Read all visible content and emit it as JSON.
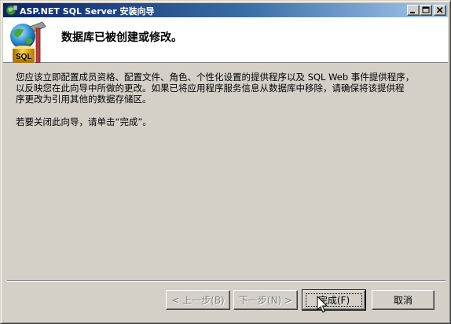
{
  "window": {
    "title": "ASP.NET SQL Server 安装向导"
  },
  "titlebar_buttons": {
    "minimize": "minimize-icon",
    "maximize": "maximize-icon",
    "close": "close-icon"
  },
  "header": {
    "title": "数据库已被创建或修改。",
    "icon_badge": "SQL"
  },
  "body": {
    "paragraph1_line1": "您应该立即配置成员资格、配置文件、角色、个性化设置的提供程序以及 SQL Web 事件提供程序，",
    "paragraph1_line2": "以反映您在此向导中所做的更改。如果已将应用程序服务信息从数据库中移除，请确保将该提供程",
    "paragraph1_line3": "序更改为引用其他的数据存储区。",
    "paragraph2": "若要关闭此向导，请单击“完成”。"
  },
  "buttons": {
    "back": "< 上一步(B)",
    "next": "下一步(N) >",
    "finish": "完成(F)",
    "cancel": "取消"
  },
  "colors": {
    "titlebar_start": "#0a246a",
    "titlebar_end": "#a6caf0",
    "face": "#d4d0c8"
  }
}
